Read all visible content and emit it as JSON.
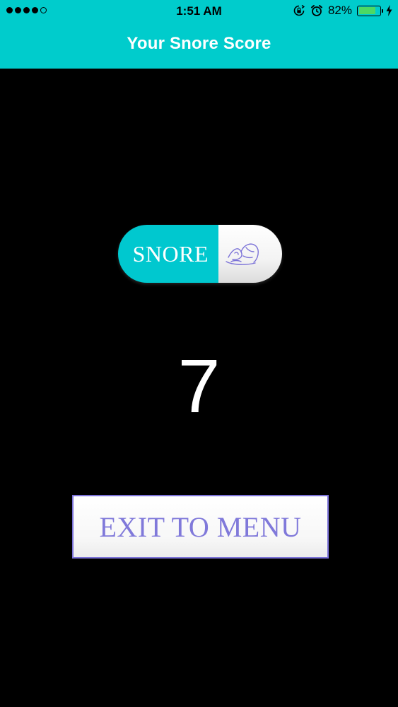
{
  "status_bar": {
    "time": "1:51 AM",
    "battery_percent": "82%",
    "battery_level": 0.82,
    "signal_bars_filled": 4,
    "signal_bars_total": 5,
    "icons": [
      "rotation-lock-icon",
      "alarm-icon",
      "charging-bolt-icon"
    ]
  },
  "nav": {
    "title": "Your Snore Score"
  },
  "pill": {
    "label": "SNORE",
    "icon": "sleeping-person-icon"
  },
  "score": {
    "value": "7"
  },
  "exit_button": {
    "label": "EXIT TO MENU"
  },
  "colors": {
    "header": "#00CCCC",
    "pill_teal": "#00C8CF",
    "background": "#000000",
    "button_text": "#8079DA",
    "button_border": "#7B72D8",
    "battery_fill": "#4CD964"
  }
}
